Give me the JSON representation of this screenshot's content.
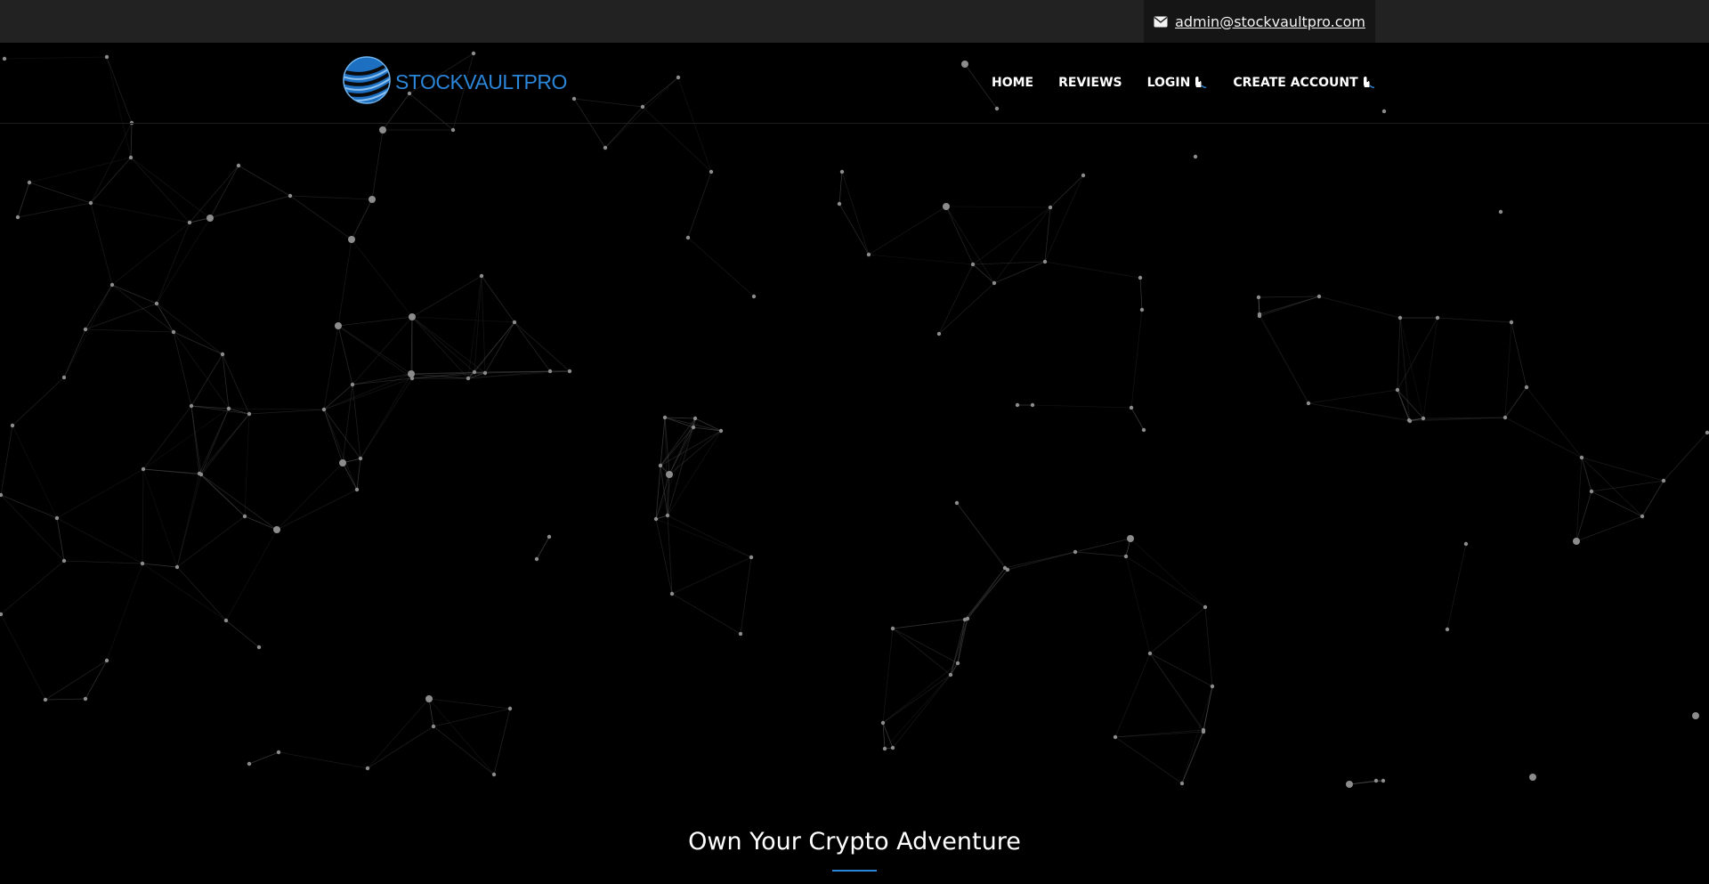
{
  "topbar": {
    "email": "admin@stockvaultpro.com",
    "email_icon": "envelope-icon"
  },
  "header": {
    "logo_text": "STOCKVAULTPRO",
    "logo_icon": "striped-globe-icon",
    "nav": [
      {
        "label": "HOME",
        "icon": null
      },
      {
        "label": "REVIEWS",
        "icon": null
      },
      {
        "label": "LOGIN",
        "icon": "hand-pointer-icon"
      },
      {
        "label": "CREATE ACCOUNT",
        "icon": "hand-pointer-icon"
      }
    ]
  },
  "hero": {
    "title": "Own Your Crypto Adventure"
  },
  "colors": {
    "background": "#000000",
    "topbar": "#222222",
    "email_box": "#151515",
    "accent": "#2b85d8",
    "network_line": "#5a5a5a",
    "network_node": "#8c8c8c"
  }
}
